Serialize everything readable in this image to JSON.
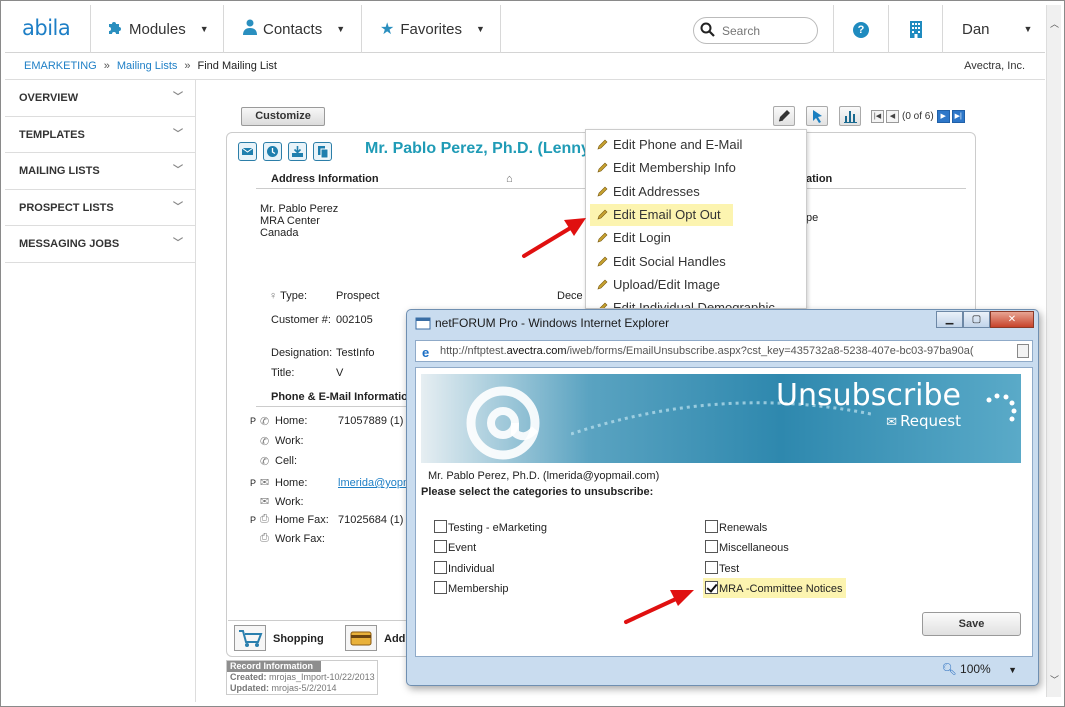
{
  "app": {
    "logo": "abila"
  },
  "nav": {
    "modules": "Modules",
    "contacts": "Contacts",
    "favorites": "Favorites",
    "search_placeholder": "Search",
    "user": "Dan"
  },
  "breadcrumb": {
    "items": [
      "EMARKETING",
      "Mailing Lists",
      "Find Mailing List"
    ],
    "sep": "»",
    "org": "Avectra, Inc."
  },
  "sidebar": {
    "items": [
      {
        "label": "OVERVIEW"
      },
      {
        "label": "TEMPLATES"
      },
      {
        "label": "MAILING LISTS"
      },
      {
        "label": "PROSPECT LISTS"
      },
      {
        "label": "MESSAGING JOBS"
      }
    ]
  },
  "toolbar": {
    "customize": "Customize",
    "pager": "(0 of 6)"
  },
  "profile": {
    "name": "Mr. Pablo Perez, Ph.D. (Lenny)",
    "address_header": "Address Information",
    "right_header_fragment": "ation",
    "address_lines": [
      "Mr. Pablo Perez",
      "MRA Center",
      "Canada"
    ],
    "right_fragment": "pe",
    "type_label": "Type:",
    "type_value": "Prospect",
    "deceased_fragment": "Dece",
    "customer_label": "Customer #:",
    "customer_value": "002105",
    "designation_label": "Designation:",
    "designation_value": "TestInfo",
    "title_label": "Title:",
    "title_value": "V",
    "phone_header": "Phone & E-Mail Information",
    "home_label": "Home:",
    "home_value": "71057889 (1)",
    "work_label": "Work:",
    "cell_label": "Cell:",
    "email_home_label": "Home:",
    "email_home_value": "lmerida@yopm",
    "email_work_label": "Work:",
    "home_fax_label": "Home Fax:",
    "home_fax_value": "71025684 (1)",
    "work_fax_label": "Work Fax:",
    "p_marker": "P",
    "shopping": "Shopping",
    "add_fragment": "Add"
  },
  "record_info": {
    "header": "Record Information",
    "created_label": "Created:",
    "created_value": "mrojas_Import-10/22/2013",
    "updated_label": "Updated:",
    "updated_value": "mrojas-5/2/2014"
  },
  "context_menu": {
    "items": [
      "Edit Phone and E-Mail",
      "Edit Membership Info",
      "Edit Addresses",
      "Edit Email Opt Out",
      "Edit Login",
      "Edit Social Handles",
      "Upload/Edit Image",
      "Edit Individual Demographic"
    ],
    "highlighted_index": 3
  },
  "popup": {
    "window_title": "netFORUM Pro - Windows Internet Explorer",
    "url_prefix": "http://nftptest.",
    "url_domain": "avectra.com",
    "url_suffix": "/iweb/forms/EmailUnsubscribe.aspx?cst_key=435732a8-5238-407e-bc03-97ba90a(",
    "banner_title": "Unsubscribe",
    "banner_sub": "Request",
    "recipient": "Mr. Pablo Perez, Ph.D. (lmerida@yopmail.com)",
    "instruction": "Please select the categories to unsubscribe:",
    "categories_left": [
      {
        "label": "Testing - eMarketing",
        "checked": false
      },
      {
        "label": "Event",
        "checked": false
      },
      {
        "label": "Individual",
        "checked": false
      },
      {
        "label": "Membership",
        "checked": false
      }
    ],
    "categories_right": [
      {
        "label": "Renewals",
        "checked": false
      },
      {
        "label": "Miscellaneous",
        "checked": false
      },
      {
        "label": "Test",
        "checked": false
      },
      {
        "label": "MRA -Committee Notices",
        "checked": true
      }
    ],
    "save": "Save",
    "zoom": "100%"
  },
  "colors": {
    "brand": "#1e7fc6",
    "name_teal": "#1f9bb6",
    "highlight": "#fcf4b0",
    "arrow_red": "#e01010"
  }
}
